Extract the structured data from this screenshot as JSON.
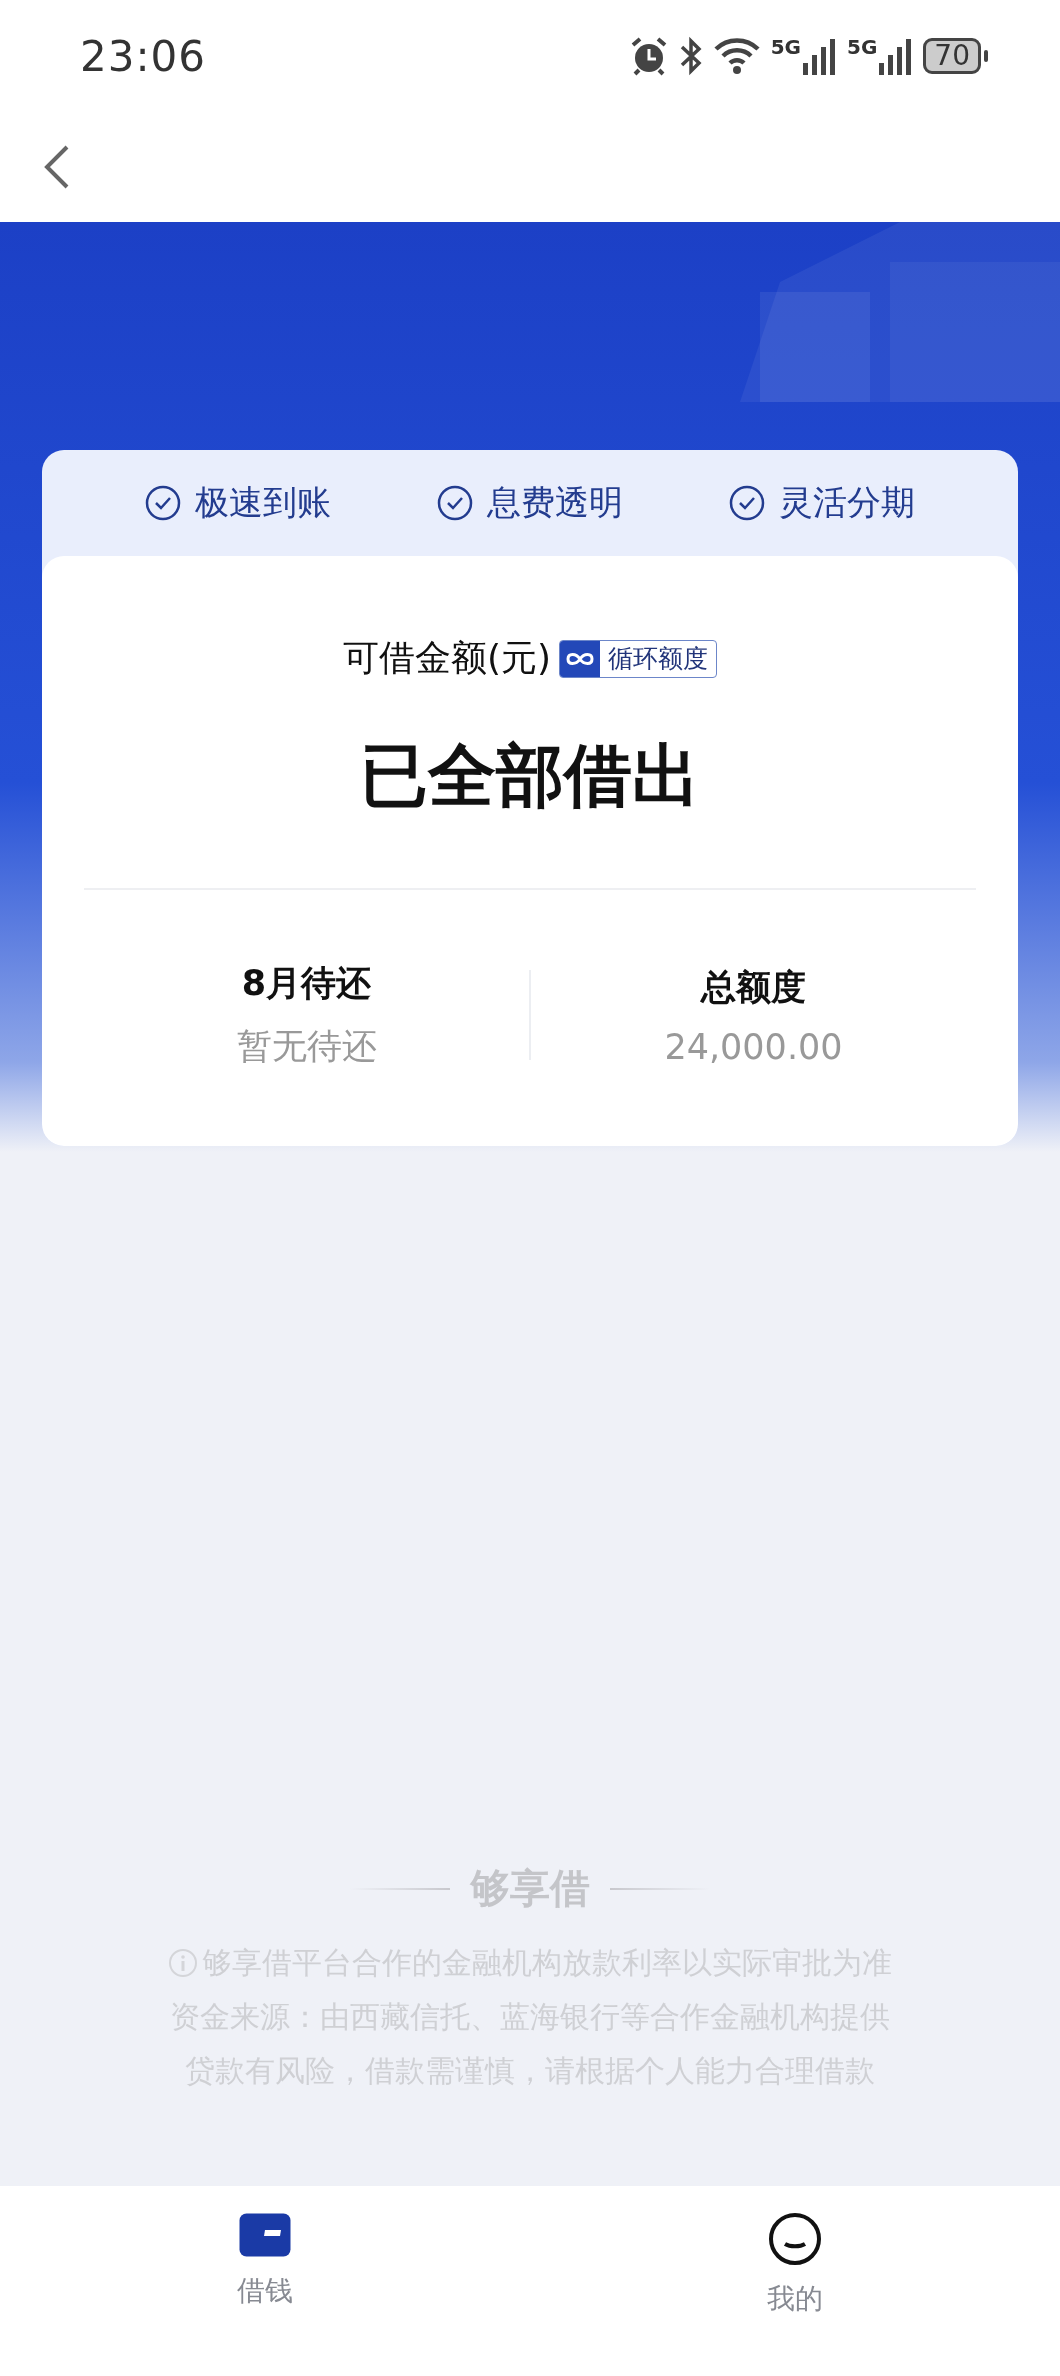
{
  "status_bar": {
    "time": "23:06",
    "networks": [
      {
        "label": "5G"
      },
      {
        "label": "5G"
      }
    ],
    "battery": "70"
  },
  "hero": {
    "features": [
      "极速到账",
      "息费透明",
      "灵活分期"
    ],
    "amount_label": "可借金额(元)",
    "badge": "循环额度",
    "amount": "已全部借出",
    "stats": [
      {
        "label": "8月待还",
        "value": "暂无待还"
      },
      {
        "label": "总额度",
        "value": "24,000.00"
      }
    ]
  },
  "footer": {
    "brand": "够享借",
    "notes": [
      {
        "text": "够享借平台合作的金融机构放款利率以实际审批为准",
        "info_icon": true
      },
      {
        "text": "资金来源：由西藏信托、蓝海银行等合作金融机构提供",
        "info_icon": false
      },
      {
        "text": "贷款有风险，借款需谨慎，请根据个人能力合理借款",
        "info_icon": false
      }
    ]
  },
  "tab_bar": [
    {
      "label": "借钱",
      "selected": true
    },
    {
      "label": "我的",
      "selected": false
    }
  ]
}
